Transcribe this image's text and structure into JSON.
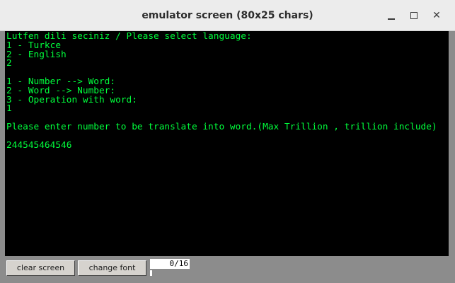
{
  "window": {
    "title": "emulator screen (80x25 chars)",
    "controls": {
      "minimize": "minimize",
      "maximize": "maximize",
      "close": "✕"
    }
  },
  "terminal": {
    "text_color": "#00ff3c",
    "background": "#000000",
    "lines": [
      "Lutfen dili seciniz / Please select language:",
      "1 - Turkce",
      "2 - English",
      "2",
      "",
      "1 - Number --> Word:",
      "2 - Word --> Number:",
      "3 - Operation with word:",
      "1",
      "",
      "Please enter number to be translate into word.(Max Trillion , trillion include)",
      "",
      "244545464546"
    ]
  },
  "toolbar": {
    "clear_label": "clear screen",
    "font_label": "change font",
    "counter": "0/16"
  }
}
